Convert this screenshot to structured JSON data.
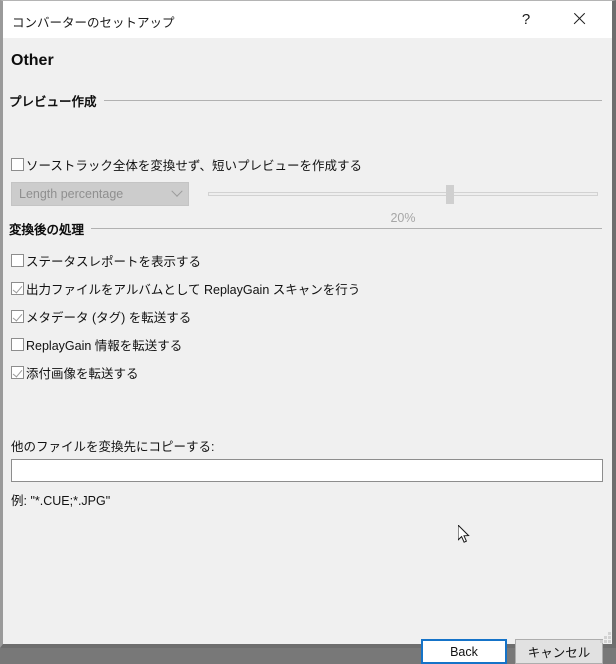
{
  "window": {
    "title": "コンバーターのセットアップ",
    "help_icon": "question-mark-icon",
    "close_icon": "close-icon",
    "page_title": "Other",
    "accent_color": "#1573c8",
    "body_color": "#f0f0f0"
  },
  "preview_group": {
    "header": "プレビュー作成",
    "checkbox": {
      "label": "ソーストラック全体を変換せず、短いプレビューを作成する",
      "checked": false
    },
    "mode_select": {
      "value": "Length percentage",
      "disabled": true,
      "arrow_icon": "chevron-down-icon"
    },
    "slider": {
      "value_label": "20%",
      "percent_position": 62,
      "disabled": true
    }
  },
  "post_conversion_group": {
    "header": "変換後の処理",
    "checkboxes": [
      {
        "label": "ステータスレポートを表示する",
        "checked": false
      },
      {
        "label": "出力ファイルをアルバムとして  ReplayGain スキャンを行う",
        "checked": true
      },
      {
        "label": "メタデータ (タグ) を転送する",
        "checked": true
      },
      {
        "label": "ReplayGain 情報を転送する",
        "checked": false
      },
      {
        "label": "添付画像を転送する",
        "checked": true
      }
    ],
    "copy_files": {
      "label": "他のファイルを変換先にコピーする:",
      "value": "",
      "placeholder": "",
      "hint": "例: \"*.CUE;*.JPG\""
    }
  },
  "footer": {
    "back_label": "Back",
    "cancel_label": "キャンセル"
  }
}
